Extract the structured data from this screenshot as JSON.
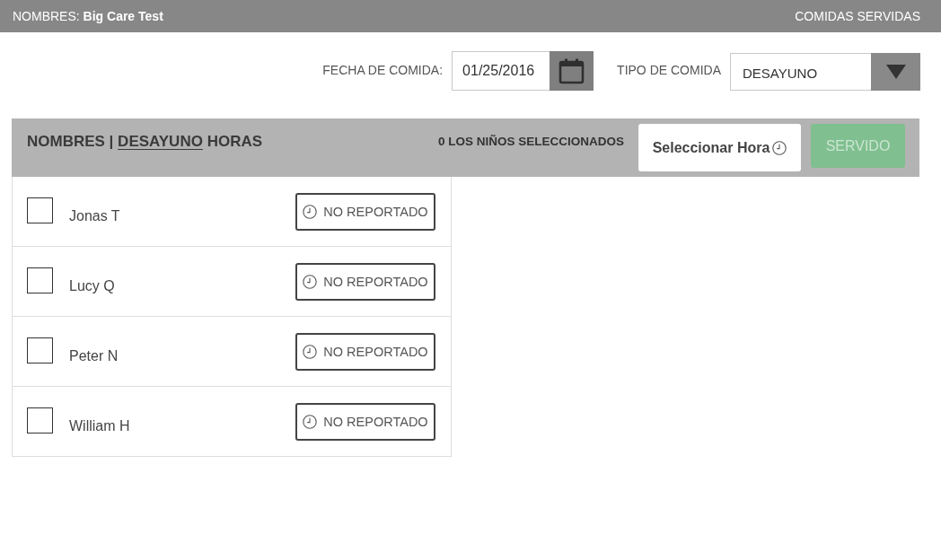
{
  "header": {
    "center": "NOMBRES: **Big Care Test**",
    "title": "COMIDAS SERVIDAS"
  },
  "filters": {
    "date_label": "FECHA DE COMIDA:",
    "date_value": "01/25/2016",
    "meal_type_label": "TIPO DE COMIDA",
    "meal_type_value": "DESAYUNO"
  },
  "list_header": {
    "title_prefix": "NOMBRES |",
    "meal": "DESAYUNO",
    "title_suffix": "HORAS",
    "selected_count": "0 LOS NIÑOS SELECCIONADOS",
    "select_time_button": "Seleccionar Hora",
    "served_button": {
      "label": "SERVIDO",
      "disabled": true
    }
  },
  "roster": [
    {
      "name": "Jonas T",
      "checked": false,
      "status": "NO REPORTADO"
    },
    {
      "name": "Lucy Q",
      "checked": false,
      "status": "NO REPORTADO"
    },
    {
      "name": "Peter N",
      "checked": false,
      "status": "NO REPORTADO"
    },
    {
      "name": "William H",
      "checked": false,
      "status": "NO REPORTADO"
    }
  ]
}
